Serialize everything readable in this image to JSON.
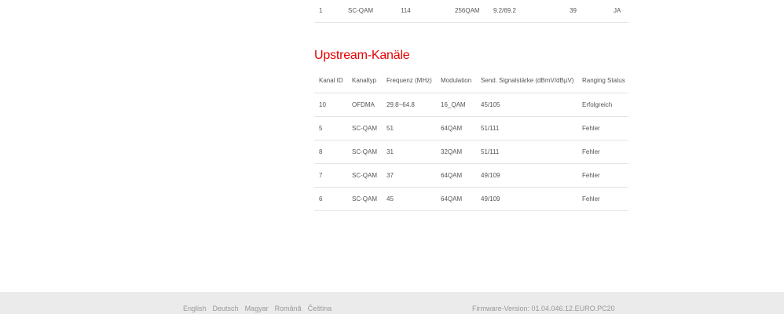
{
  "downstream": {
    "rows": [
      [
        "1",
        "SC-QAM",
        "114",
        "256QAM",
        "9.2/69.2",
        "39",
        "JA"
      ]
    ]
  },
  "upstream": {
    "title": "Upstream-Kanäle",
    "headers": [
      "Kanal ID",
      "Kanaltyp",
      "Frequenz (MHz)",
      "Modulation",
      "Send. Signalstärke (dBmV/dBµV)",
      "Ranging Status"
    ],
    "rows": [
      [
        "10",
        "OFDMA",
        "29.8~64.8",
        "16_QAM",
        "45/105",
        "Erfolgreich"
      ],
      [
        "5",
        "SC-QAM",
        "51",
        "64QAM",
        "51/111",
        "Fehler"
      ],
      [
        "8",
        "SC-QAM",
        "31",
        "32QAM",
        "51/111",
        "Fehler"
      ],
      [
        "7",
        "SC-QAM",
        "37",
        "64QAM",
        "49/109",
        "Fehler"
      ],
      [
        "6",
        "SC-QAM",
        "45",
        "64QAM",
        "49/109",
        "Fehler"
      ]
    ]
  },
  "footer": {
    "languages": [
      "English",
      "Deutsch",
      "Magyar",
      "Română",
      "Čeština"
    ],
    "firmware": "Firmware-Version: 01.04.046.12.EURO.PC20"
  }
}
